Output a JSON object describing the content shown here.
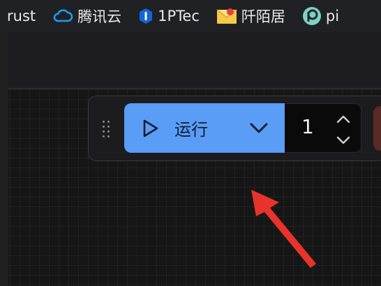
{
  "bookmarks": [
    {
      "label": "rust",
      "icon": "none"
    },
    {
      "label": "腾讯云",
      "icon": "cloud-icon"
    },
    {
      "label": "1PTec",
      "icon": "shield-icon"
    },
    {
      "label": "阡陌居",
      "icon": "envelope-icon"
    },
    {
      "label": "pi",
      "icon": "p-logo-icon"
    }
  ],
  "toolbar": {
    "run_label": "运行",
    "run_count": "1"
  },
  "colors": {
    "run_button": "#5a9df7",
    "annotation_arrow": "#e8332a",
    "bookmark_bar": "#202124"
  }
}
